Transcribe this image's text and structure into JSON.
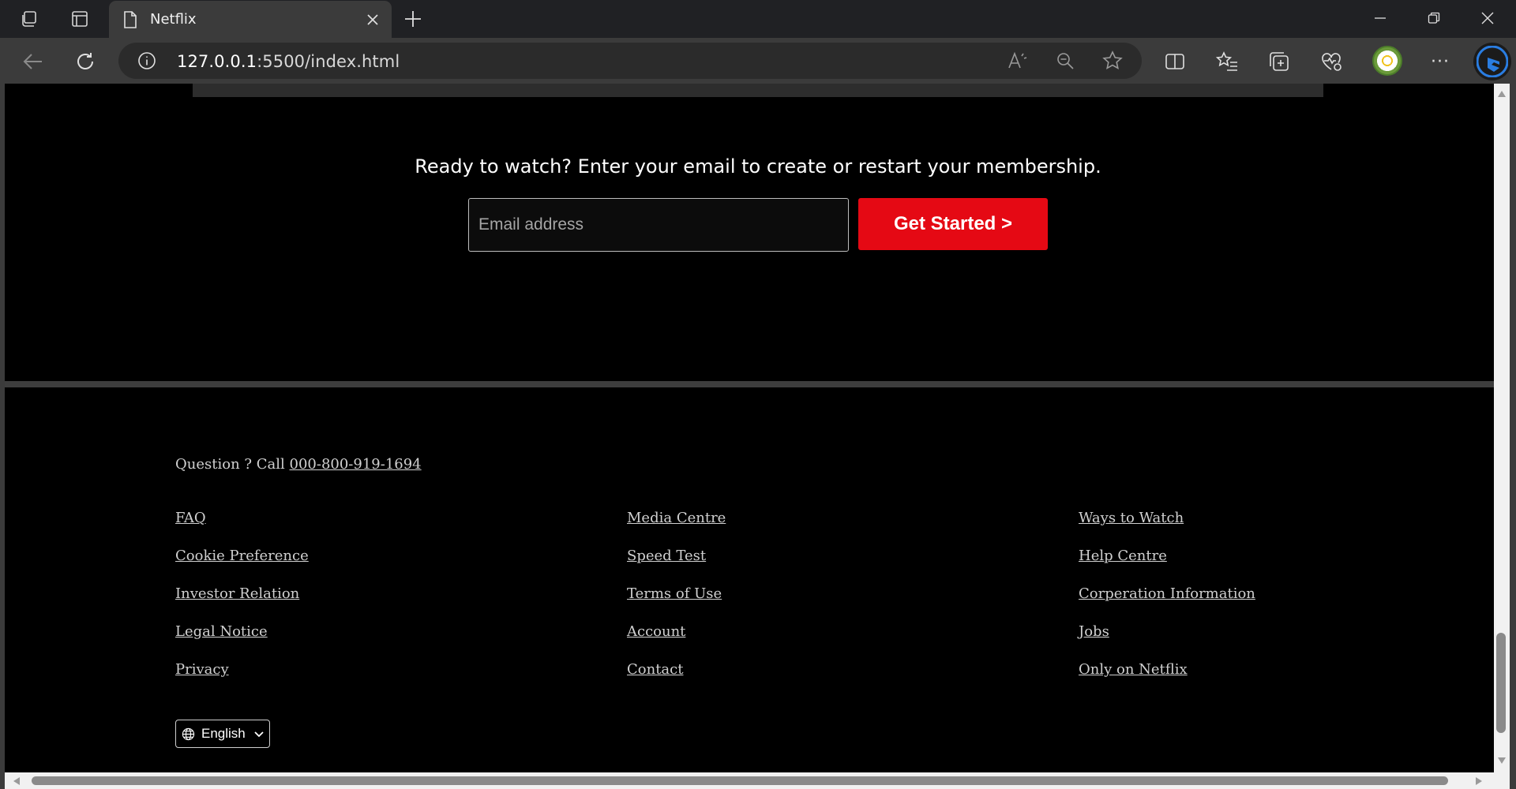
{
  "browser": {
    "tab": {
      "title": "Netflix",
      "close_glyph": "✕"
    },
    "new_tab_glyph": "+",
    "address": {
      "host": "127.0.0.1",
      "rest": ":5500/index.html"
    },
    "window_controls": {
      "minimize": "—",
      "maximize": "❐",
      "close": "✕"
    },
    "more_glyph": "···"
  },
  "page": {
    "cta": {
      "text": "Ready to watch? Enter your email to create or restart your membership.",
      "email_placeholder": "Email address",
      "button_label": "Get Started >"
    },
    "footer": {
      "question_prefix": "Question ? Call ",
      "phone": "000-800-919-1694",
      "columns": [
        [
          "FAQ",
          "Cookie Preference",
          "Investor Relation",
          "Legal Notice",
          "Privacy"
        ],
        [
          "Media Centre",
          "Speed Test",
          "Terms of Use",
          "Account",
          "Contact"
        ],
        [
          "Ways to Watch",
          "Help Centre",
          "Corperation Information",
          "Jobs",
          "Only on Netflix"
        ]
      ],
      "language": "English"
    }
  },
  "colors": {
    "accent_red": "#e50914",
    "page_bg": "#000000",
    "link_text": "#d0d0d0",
    "chrome_dark": "#202124",
    "chrome_toolbar": "#3b3b3b"
  }
}
